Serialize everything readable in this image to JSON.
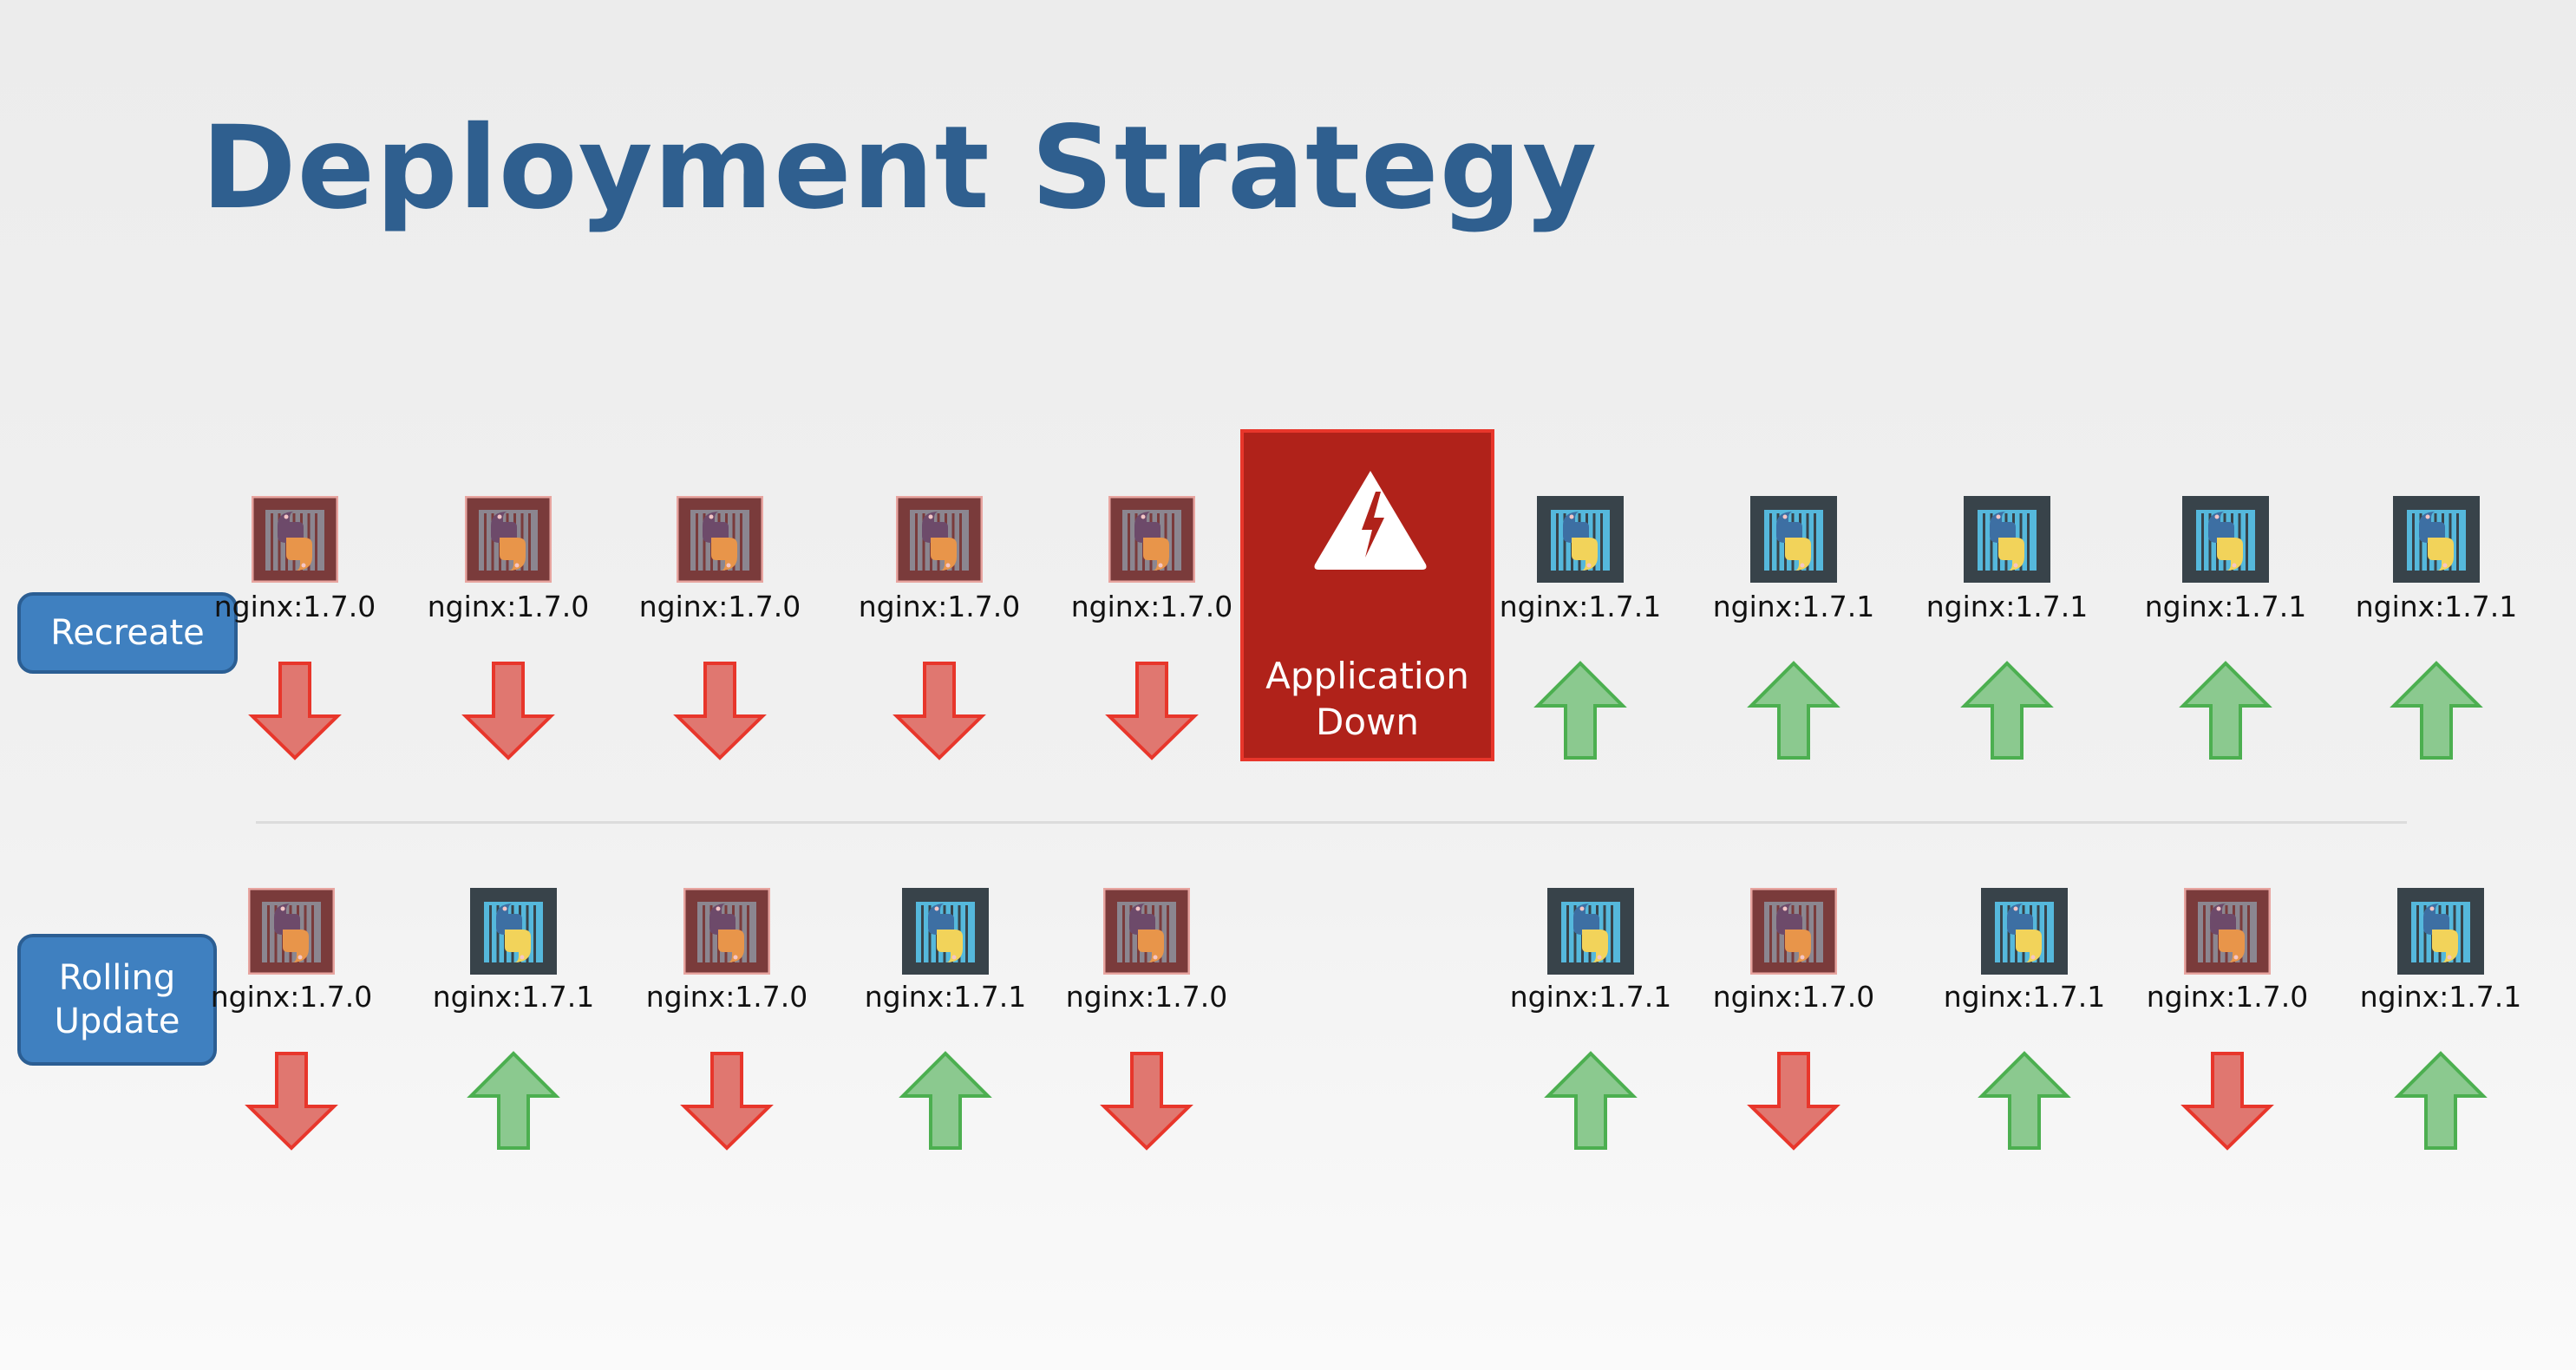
{
  "title": "Deployment Strategy",
  "colors": {
    "title": "#2f5f8f",
    "strategy_button": "#3f80c0",
    "down_box": "#b0221a",
    "arrow_down_fill": "#e07770",
    "arrow_down_stroke": "#e8362b",
    "arrow_up_fill": "#8bc98f",
    "arrow_up_stroke": "#4caf50",
    "old_pod_frame": "#7a3b3b",
    "new_pod_frame": "#38434a"
  },
  "strategies": {
    "recreate": {
      "label": "Recreate",
      "pods": [
        {
          "label": "nginx:1.7.0",
          "version": "old",
          "direction": "down"
        },
        {
          "label": "nginx:1.7.0",
          "version": "old",
          "direction": "down"
        },
        {
          "label": "nginx:1.7.0",
          "version": "old",
          "direction": "down"
        },
        {
          "label": "nginx:1.7.0",
          "version": "old",
          "direction": "down"
        },
        {
          "label": "nginx:1.7.0",
          "version": "old",
          "direction": "down"
        },
        {
          "label": "nginx:1.7.1",
          "version": "new",
          "direction": "up"
        },
        {
          "label": "nginx:1.7.1",
          "version": "new",
          "direction": "up"
        },
        {
          "label": "nginx:1.7.1",
          "version": "new",
          "direction": "up"
        },
        {
          "label": "nginx:1.7.1",
          "version": "new",
          "direction": "up"
        },
        {
          "label": "nginx:1.7.1",
          "version": "new",
          "direction": "up"
        }
      ],
      "downtime": {
        "line1": "Application",
        "line2": "Down",
        "icon": "warning-lightning-icon"
      }
    },
    "rolling": {
      "label_line1": "Rolling",
      "label_line2": "Update",
      "pods": [
        {
          "label": "nginx:1.7.0",
          "version": "old",
          "direction": "down"
        },
        {
          "label": "nginx:1.7.1",
          "version": "new",
          "direction": "up"
        },
        {
          "label": "nginx:1.7.0",
          "version": "old",
          "direction": "down"
        },
        {
          "label": "nginx:1.7.1",
          "version": "new",
          "direction": "up"
        },
        {
          "label": "nginx:1.7.0",
          "version": "old",
          "direction": "down"
        },
        {
          "label": "nginx:1.7.1",
          "version": "new",
          "direction": "up"
        },
        {
          "label": "nginx:1.7.0",
          "version": "old",
          "direction": "down"
        },
        {
          "label": "nginx:1.7.1",
          "version": "new",
          "direction": "up"
        },
        {
          "label": "nginx:1.7.0",
          "version": "old",
          "direction": "down"
        },
        {
          "label": "nginx:1.7.1",
          "version": "new",
          "direction": "up"
        }
      ]
    }
  }
}
